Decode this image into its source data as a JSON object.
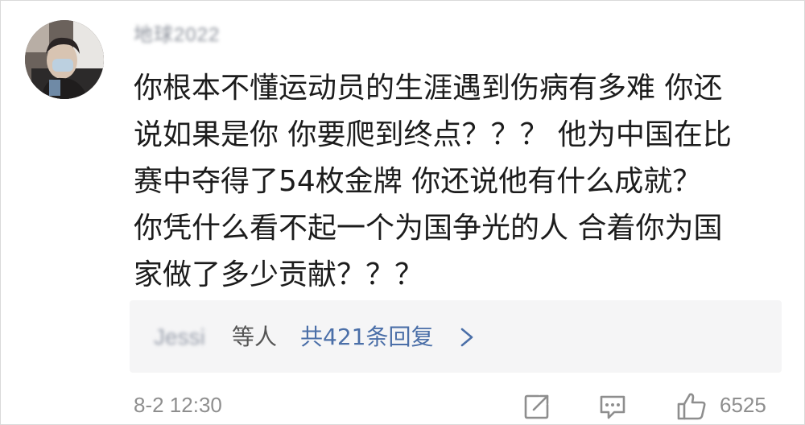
{
  "comment": {
    "username": "地球2022",
    "lines": [
      "你根本不懂运动员的生涯遇到伤病有多难 你还",
      "说如果是你 你要爬到终点？？？ 他为中国在比",
      "赛中夺得了54枚金牌 你还说他有什么成就？",
      "你凭什么看不起一个为国争光的人 合着你为国",
      "家做了多少贡献？？？"
    ],
    "replies": {
      "replier_name": "Jessi",
      "replier_suffix": "等人",
      "link_text": "共421条回复"
    },
    "timestamp": "8-2 12:30",
    "likes": "6525"
  },
  "icons": {
    "share": "share-icon",
    "reply": "comment-icon",
    "like": "thumbs-up-icon",
    "chevron": "chevron-right-icon"
  },
  "colors": {
    "text": "#1c1c1c",
    "muted": "#8e8e8e",
    "link": "#4b6fa8",
    "reply_bg": "#f5f5f6"
  }
}
